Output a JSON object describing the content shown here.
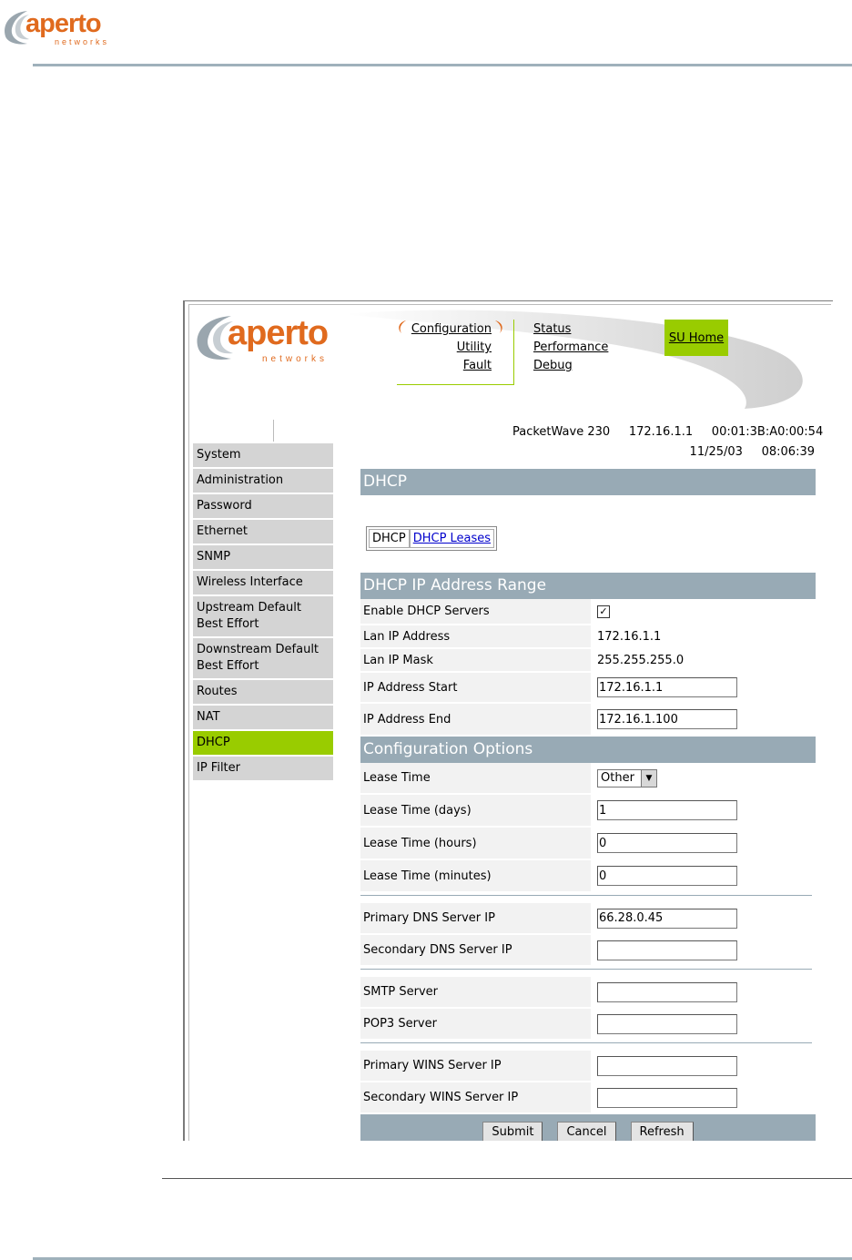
{
  "doc": {
    "logo_word": "aperto",
    "logo_sub": "networks"
  },
  "app": {
    "logo_word": "aperto",
    "logo_sub": "networks",
    "nav_left": [
      "Configuration",
      "Utility",
      "Fault"
    ],
    "nav_right": [
      "Status",
      "Performance",
      "Debug"
    ],
    "su_home": "SU Home",
    "device": "PacketWave 230",
    "ip": "172.16.1.1",
    "mac": "00:01:3B:A0:00:54",
    "date": "11/25/03",
    "time": "08:06:39"
  },
  "sidebar": {
    "items": [
      "System",
      "Administration",
      "Password",
      "Ethernet",
      "SNMP",
      "Wireless Interface",
      "Upstream Default Best Effort",
      "Downstream Default Best Effort",
      "Routes",
      "NAT",
      "DHCP",
      "IP Filter"
    ],
    "active": "DHCP"
  },
  "page": {
    "title": "DHCP",
    "tab_current": "DHCP",
    "tab_link": "DHCP Leases",
    "section1": "DHCP IP Address Range",
    "section2": "Configuration Options"
  },
  "range": {
    "enable_label": "Enable DHCP Servers",
    "enable_checked": "✓",
    "lan_ip_label": "Lan IP Address",
    "lan_ip": "172.16.1.1",
    "lan_mask_label": "Lan IP Mask",
    "lan_mask": "255.255.255.0",
    "start_label": "IP Address Start",
    "start": "172.16.1.1",
    "end_label": "IP Address End",
    "end": "172.16.1.100"
  },
  "options": {
    "lease_label": "Lease Time",
    "lease_value": "Other",
    "days_label": "Lease Time (days)",
    "days": "1",
    "hours_label": "Lease Time (hours)",
    "hours": "0",
    "minutes_label": "Lease Time (minutes)",
    "minutes": "0",
    "dns1_label": "Primary DNS Server IP",
    "dns1": "66.28.0.45",
    "dns2_label": "Secondary DNS Server IP",
    "dns2": "",
    "smtp_label": "SMTP Server",
    "smtp": "",
    "pop3_label": "POP3 Server",
    "pop3": "",
    "wins1_label": "Primary WINS Server IP",
    "wins1": "",
    "wins2_label": "Secondary WINS Server IP",
    "wins2": ""
  },
  "buttons": {
    "submit": "Submit",
    "cancel": "Cancel",
    "refresh": "Refresh"
  },
  "colors": {
    "brand_orange": "#e06a1e",
    "accent_green": "#99cc00",
    "band_blue_gray": "#98aab5"
  }
}
